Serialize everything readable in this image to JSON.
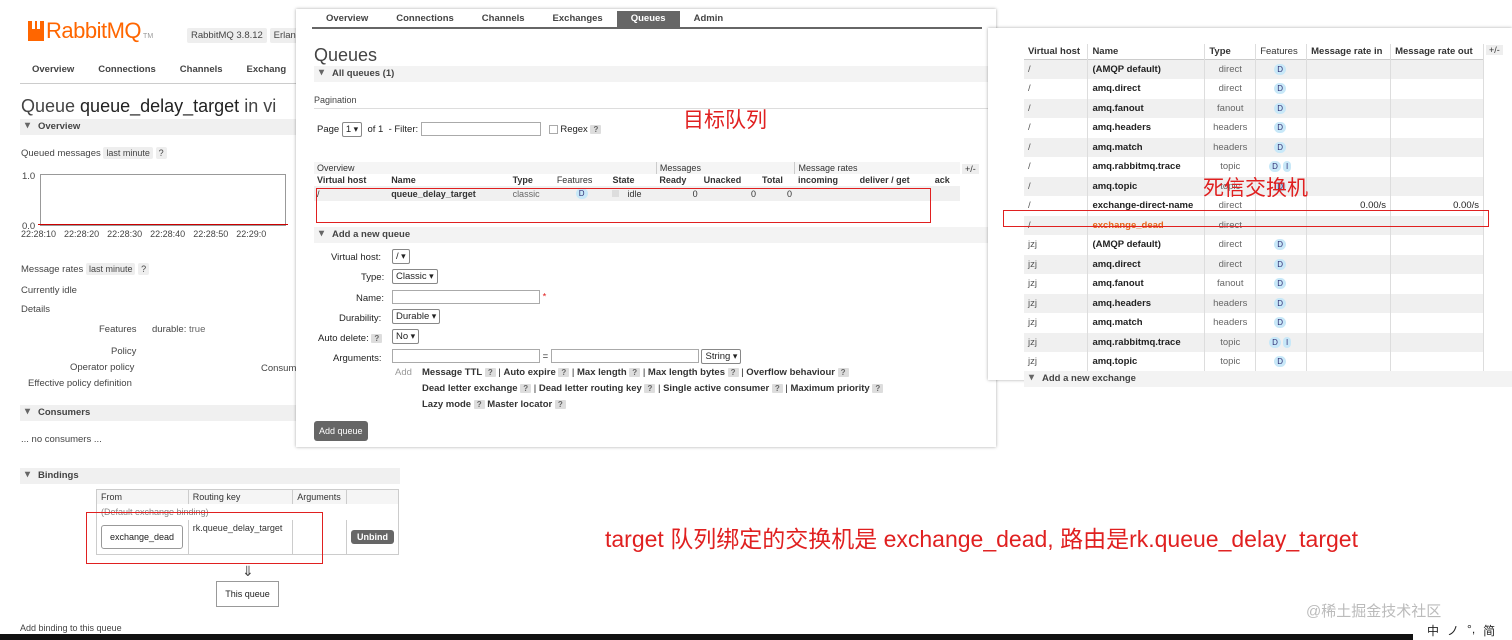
{
  "background_page": {
    "logo_text": "RabbitMQ",
    "logo_tm": "TM",
    "version": "RabbitMQ 3.8.12",
    "erlang_partial": "Erlan",
    "nav": [
      "Overview",
      "Connections",
      "Channels",
      "Exchang"
    ],
    "title_prefix": "Queue ",
    "title_name": "queue_delay_target",
    "title_suffix": " in vi",
    "overview_label": "Overview",
    "queued_messages_label": "Queued messages",
    "last_minute": "last minute",
    "help": "?",
    "chart_y_top": "1.0",
    "chart_y_bottom": "0.0",
    "chart_ticks": [
      "22:28:10",
      "22:28:20",
      "22:28:30",
      "22:28:40",
      "22:28:50",
      "22:29:0"
    ],
    "message_rates_label": "Message rates",
    "currently_idle": "Currently idle",
    "details_label": "Details",
    "features_label": "Features",
    "features_value": "durable: ",
    "features_true": "true",
    "policy_label": "Policy",
    "operator_policy_label": "Operator policy",
    "consumers_partial": "Consum",
    "effective_policy_label": "Effective policy definition",
    "consumers_label": "Consumers",
    "no_consumers": "... no consumers ...",
    "bindings_label": "Bindings",
    "bindings_headers": [
      "From",
      "Routing key",
      "Arguments"
    ],
    "default_binding": "(Default exchange binding)",
    "binding_from": "exchange_dead",
    "binding_key": "rk.queue_delay_target",
    "unbind": "Unbind",
    "arrow": "⇓",
    "this_queue": "This queue",
    "add_binding": "Add binding to this queue"
  },
  "queues_window": {
    "nav": [
      "Overview",
      "Connections",
      "Channels",
      "Exchanges",
      "Queues",
      "Admin"
    ],
    "active_tab": "Queues",
    "title": "Queues",
    "all_queues": "All queues (1)",
    "pagination": "Pagination",
    "page_label": "Page",
    "page_value": "1",
    "of_label": "of 1",
    "filter_label": "- Filter:",
    "regex_label": "Regex",
    "help": "?",
    "group_headers": [
      "Overview",
      "Messages",
      "Message rates"
    ],
    "plus_minus": "+/-",
    "col_headers": [
      "Virtual host",
      "Name",
      "Type",
      "Features",
      "State",
      "Ready",
      "Unacked",
      "Total",
      "incoming",
      "deliver / get",
      "ack"
    ],
    "row": {
      "vhost": "/",
      "name": "queue_delay_target",
      "type": "classic",
      "feature": "D",
      "state": "idle",
      "ready": "0",
      "unacked": "0",
      "total": "0"
    },
    "add_new_queue": "Add a new queue",
    "form": {
      "vhost_label": "Virtual host:",
      "vhost_value": "/",
      "type_label": "Type:",
      "type_value": "Classic",
      "name_label": "Name:",
      "required_mark": "*",
      "durability_label": "Durability:",
      "durability_value": "Durable",
      "auto_delete_label": "Auto delete:",
      "auto_delete_value": "No",
      "arguments_label": "Arguments:",
      "equals": "=",
      "arg_type": "String",
      "add_label": "Add"
    },
    "arg_links_row1": [
      "Message TTL",
      "Auto expire",
      "Max length",
      "Max length bytes",
      "Overflow behaviour"
    ],
    "arg_links_row2": [
      "Dead letter exchange",
      "Dead letter routing key",
      "Single active consumer",
      "Maximum priority"
    ],
    "arg_links_row3": [
      "Lazy mode",
      "Master locator"
    ],
    "separator": "|",
    "add_queue_button": "Add queue"
  },
  "exchanges_window": {
    "headers": [
      "Virtual host",
      "Name",
      "Type",
      "Features",
      "Message rate in",
      "Message rate out"
    ],
    "plus_minus": "+/-",
    "rows": [
      {
        "vhost": "/",
        "name": "(AMQP default)",
        "type": "direct",
        "features": [
          "D"
        ],
        "in": "",
        "out": ""
      },
      {
        "vhost": "/",
        "name": "amq.direct",
        "type": "direct",
        "features": [
          "D"
        ],
        "in": "",
        "out": ""
      },
      {
        "vhost": "/",
        "name": "amq.fanout",
        "type": "fanout",
        "features": [
          "D"
        ],
        "in": "",
        "out": ""
      },
      {
        "vhost": "/",
        "name": "amq.headers",
        "type": "headers",
        "features": [
          "D"
        ],
        "in": "",
        "out": ""
      },
      {
        "vhost": "/",
        "name": "amq.match",
        "type": "headers",
        "features": [
          "D"
        ],
        "in": "",
        "out": ""
      },
      {
        "vhost": "/",
        "name": "amq.rabbitmq.trace",
        "type": "topic",
        "features": [
          "D",
          "I"
        ],
        "in": "",
        "out": ""
      },
      {
        "vhost": "/",
        "name": "amq.topic",
        "type": "topic",
        "features": [
          "D"
        ],
        "in": "",
        "out": ""
      },
      {
        "vhost": "/",
        "name": "exchange-direct-name",
        "type": "direct",
        "features": [],
        "in": "0.00/s",
        "out": "0.00/s"
      },
      {
        "vhost": "/",
        "name": "exchange_dead",
        "type": "direct",
        "features": [],
        "in": "",
        "out": "",
        "highlight": true
      },
      {
        "vhost": "jzj",
        "name": "(AMQP default)",
        "type": "direct",
        "features": [
          "D"
        ],
        "in": "",
        "out": ""
      },
      {
        "vhost": "jzj",
        "name": "amq.direct",
        "type": "direct",
        "features": [
          "D"
        ],
        "in": "",
        "out": ""
      },
      {
        "vhost": "jzj",
        "name": "amq.fanout",
        "type": "fanout",
        "features": [
          "D"
        ],
        "in": "",
        "out": ""
      },
      {
        "vhost": "jzj",
        "name": "amq.headers",
        "type": "headers",
        "features": [
          "D"
        ],
        "in": "",
        "out": ""
      },
      {
        "vhost": "jzj",
        "name": "amq.match",
        "type": "headers",
        "features": [
          "D"
        ],
        "in": "",
        "out": ""
      },
      {
        "vhost": "jzj",
        "name": "amq.rabbitmq.trace",
        "type": "topic",
        "features": [
          "D",
          "I"
        ],
        "in": "",
        "out": ""
      },
      {
        "vhost": "jzj",
        "name": "amq.topic",
        "type": "topic",
        "features": [
          "D"
        ],
        "in": "",
        "out": ""
      }
    ],
    "add_new_exchange": "Add a new exchange"
  },
  "annotations": {
    "target_queue": "目标队列",
    "dead_letter_exchange": "死信交换机",
    "explanation": "target 队列绑定的交换机是 exchange_dead, 路由是rk.queue_delay_target",
    "color": "#e02020"
  },
  "watermark": "@稀土掘金技术社区",
  "ime": [
    "中",
    "ノ",
    "°,",
    "简"
  ]
}
